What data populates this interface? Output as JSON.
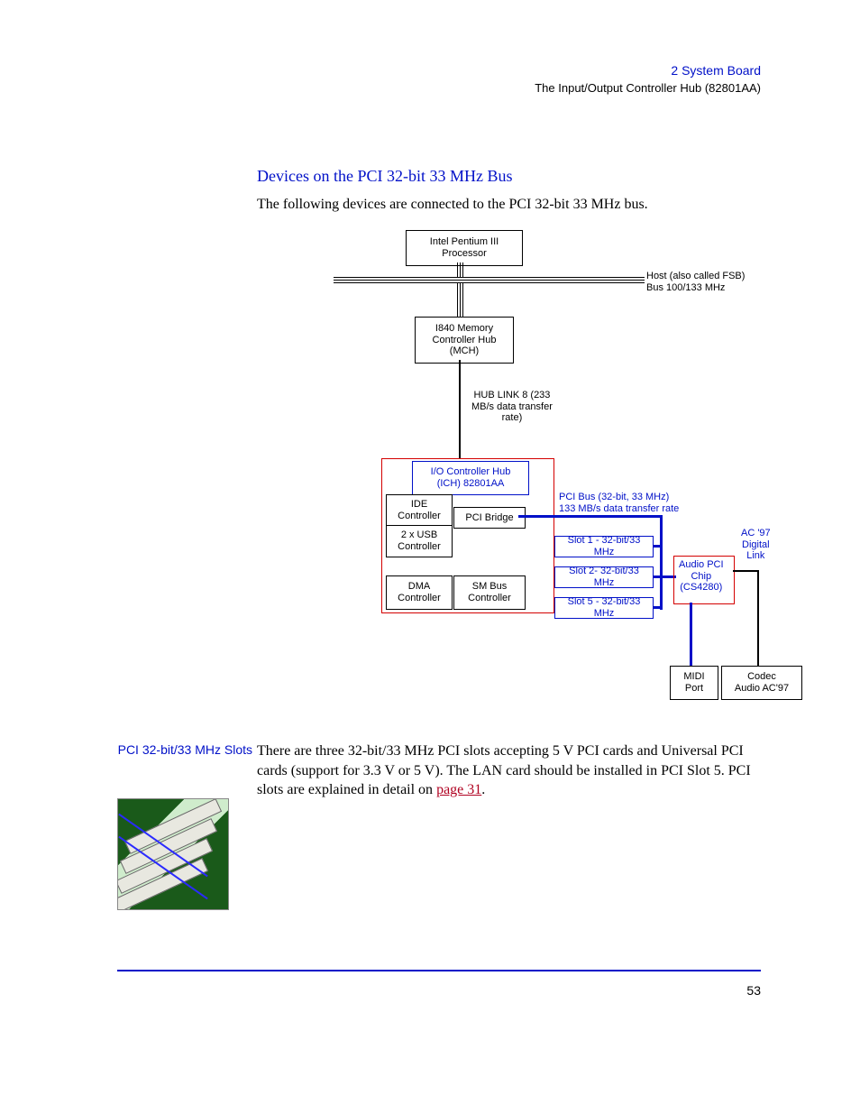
{
  "header": {
    "chapter": "2  System Board",
    "subtitle": "The Input/Output Controller Hub (82801AA)"
  },
  "section_title": "Devices on the PCI 32-bit 33 MHz Bus",
  "intro": "The following devices are connected to the PCI 32-bit 33 MHz bus.",
  "diagram": {
    "cpu": "Intel Pentium III\nProcessor",
    "host_label": "Host (also called FSB)\nBus 100/133 MHz",
    "mch": "I840 Memory\nController Hub\n(MCH)",
    "hublink": "HUB LINK 8 (233\nMB/s data transfer\nrate)",
    "ich": "I/O Controller Hub\n(ICH) 82801AA",
    "ide": "IDE\nController",
    "pci_bridge": "PCI Bridge",
    "usb": "2 x USB\nController",
    "dma": "DMA\nController",
    "smbus": "SM Bus\nController",
    "pci_bus_label": "PCI Bus (32-bit, 33 MHz)\n133 MB/s data transfer rate",
    "slot1": "Slot 1 - 32-bit/33 MHz",
    "slot2": "Slot 2- 32-bit/33 MHz",
    "slot5": "Slot 5 - 32-bit/33 MHz",
    "audio_chip": "Audio PCI\nChip\n(CS4280)",
    "ac97": "AC '97\nDigital\nLink",
    "midi": "MIDI\nPort",
    "codec": "Codec\nAudio AC'97"
  },
  "side_heading": "PCI 32-bit/33 MHz Slots",
  "body": {
    "text_before_link": "There are three 32-bit/33 MHz PCI slots accepting 5 V PCI cards and Universal PCI cards (support for 3.3 V or 5 V). The LAN card should be installed in PCI Slot 5. PCI slots are explained in detail on ",
    "link": "page 31",
    "text_after_link": "."
  },
  "page_number": "53"
}
